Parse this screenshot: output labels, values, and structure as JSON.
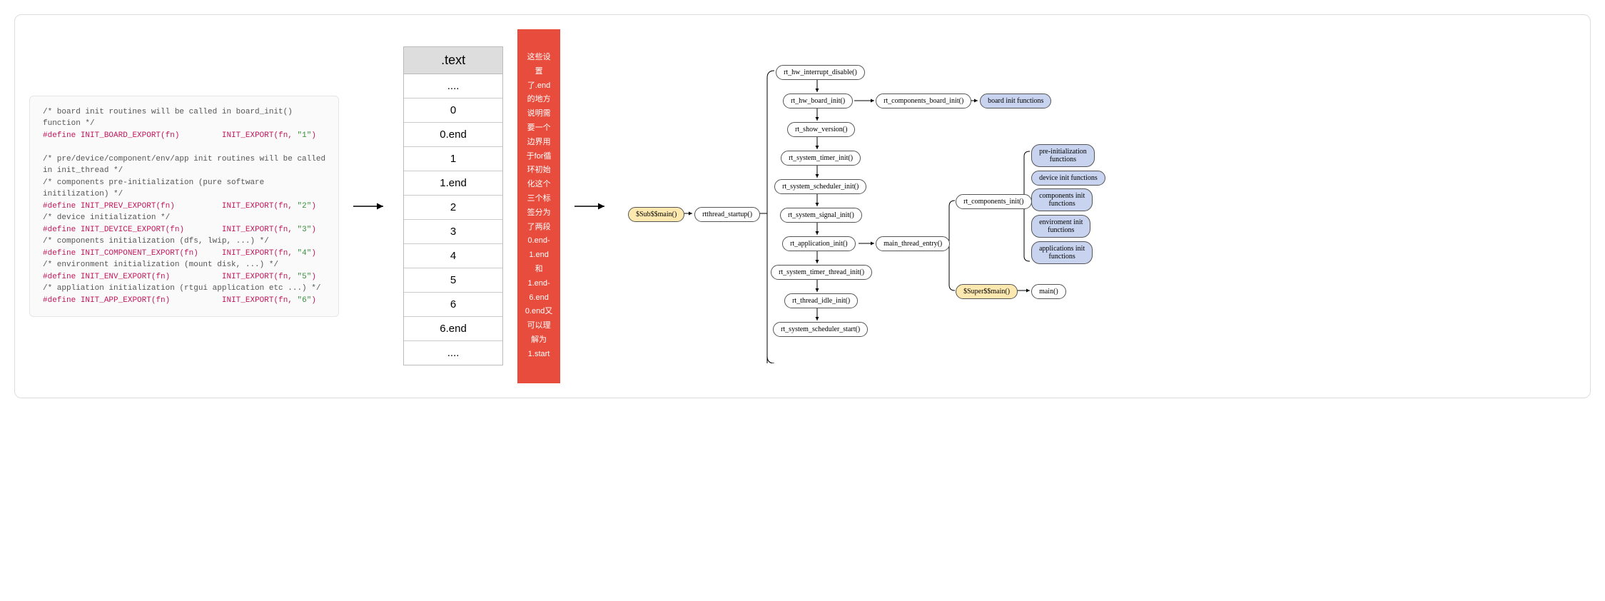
{
  "code": {
    "c1": "/* board init routines will be called in board_init()\nfunction */",
    "d1a": "#define",
    "d1b": "INIT_BOARD_EXPORT(fn)",
    "d1c": "INIT_EXPORT(fn,",
    "d1d": "\"1\"",
    "d1e": ")",
    "c2": "/* pre/device/component/env/app init routines will be called\nin init_thread */",
    "c3": "/* components pre-initialization (pure software\ninitilization) */",
    "d2a": "#define",
    "d2b": "INIT_PREV_EXPORT(fn)",
    "d2c": "INIT_EXPORT(fn,",
    "d2d": "\"2\"",
    "d2e": ")",
    "c4": "/* device initialization */",
    "d3a": "#define",
    "d3b": "INIT_DEVICE_EXPORT(fn)",
    "d3c": "INIT_EXPORT(fn,",
    "d3d": "\"3\"",
    "d3e": ")",
    "c5": "/* components initialization (dfs, lwip, ...) */",
    "d4a": "#define",
    "d4b": "INIT_COMPONENT_EXPORT(fn)",
    "d4c": "INIT_EXPORT(fn,",
    "d4d": "\"4\"",
    "d4e": ")",
    "c6": "/* environment initialization (mount disk, ...) */",
    "d5a": "#define",
    "d5b": "INIT_ENV_EXPORT(fn)",
    "d5c": "INIT_EXPORT(fn,",
    "d5d": "\"5\"",
    "d5e": ")",
    "c7": "/* appliation initialization (rtgui application etc ...) */",
    "d6a": "#define",
    "d6b": "INIT_APP_EXPORT(fn)",
    "d6c": "INIT_EXPORT(fn,",
    "d6d": "\"6\"",
    "d6e": ")"
  },
  "table": {
    "header": ".text",
    "rows": [
      "....",
      "0",
      "0.end",
      "1",
      "1.end",
      "2",
      "3",
      "4",
      "5",
      "6",
      "6.end",
      "...."
    ]
  },
  "annotation": "这些设置了.end的地方说明需要一个边界用于for循环初始化这个三个标签分为了两段\n0.end-1.end\n和\n1.end-6.end\n0.end又可以理解为1.start",
  "flow": {
    "sub_main": "$Sub$$main()",
    "rtthread_startup": "rtthread_startup()",
    "hw_interrupt": "rt_hw_interrupt_disable()",
    "hw_board": "rt_hw_board_init()",
    "comp_board": "rt_components_board_init()",
    "board_init_fn": "board init functions",
    "show_version": "rt_show_version()",
    "timer_init": "rt_system_timer_init()",
    "scheduler_init": "rt_system_scheduler_init()",
    "signal_init": "rt_system_signal_init()",
    "app_init": "rt_application_init()",
    "main_thread": "main_thread_entry()",
    "timer_thread": "rt_system_timer_thread_init()",
    "idle_init": "rt_thread_idle_init()",
    "scheduler_start": "rt_system_scheduler_start()",
    "comp_init": "rt_components_init()",
    "pre_init": "pre-initialization\nfunctions",
    "dev_init": "device init functions",
    "comp_init_fn": "components init\nfunctions",
    "env_init": "enviroment init\nfunctions",
    "app_init_fn": "applications init\nfunctions",
    "super_main": "$Super$$main()",
    "main": "main()"
  },
  "chart_data": {
    "type": "diagram",
    "title": "RT-Thread initialization flow",
    "code_macros": [
      {
        "macro": "INIT_BOARD_EXPORT(fn)",
        "expands_to": "INIT_EXPORT(fn, \"1\")",
        "comment": "board init routines will be called in board_init() function"
      },
      {
        "macro": "INIT_PREV_EXPORT(fn)",
        "expands_to": "INIT_EXPORT(fn, \"2\")",
        "comment": "components pre-initialization (pure software initilization)"
      },
      {
        "macro": "INIT_DEVICE_EXPORT(fn)",
        "expands_to": "INIT_EXPORT(fn, \"3\")",
        "comment": "device initialization"
      },
      {
        "macro": "INIT_COMPONENT_EXPORT(fn)",
        "expands_to": "INIT_EXPORT(fn, \"4\")",
        "comment": "components initialization (dfs, lwip, ...)"
      },
      {
        "macro": "INIT_ENV_EXPORT(fn)",
        "expands_to": "INIT_EXPORT(fn, \"5\")",
        "comment": "environment initialization (mount disk, ...)"
      },
      {
        "macro": "INIT_APP_EXPORT(fn)",
        "expands_to": "INIT_EXPORT(fn, \"6\")",
        "comment": "appliation initialization (rtgui application etc ...)"
      }
    ],
    "text_section_layout": [
      "....",
      "0",
      "0.end",
      "1",
      "1.end",
      "2",
      "3",
      "4",
      "5",
      "6",
      "6.end",
      "...."
    ],
    "annotation_zh": "这些设置了.end的地方说明需要一个边界用于for循环初始化这个三个标签分为了两段 0.end-1.end 和 1.end-6.end 0.end又可以理解为1.start",
    "flow_edges": [
      [
        "$Sub$$main()",
        "rtthread_startup()"
      ],
      [
        "rtthread_startup()",
        "rt_hw_interrupt_disable()"
      ],
      [
        "rt_hw_interrupt_disable()",
        "rt_hw_board_init()"
      ],
      [
        "rt_hw_board_init()",
        "rt_components_board_init()"
      ],
      [
        "rt_components_board_init()",
        "board init functions"
      ],
      [
        "rt_hw_board_init()",
        "rt_show_version()"
      ],
      [
        "rt_show_version()",
        "rt_system_timer_init()"
      ],
      [
        "rt_system_timer_init()",
        "rt_system_scheduler_init()"
      ],
      [
        "rt_system_scheduler_init()",
        "rt_system_signal_init()"
      ],
      [
        "rt_system_signal_init()",
        "rt_application_init()"
      ],
      [
        "rt_application_init()",
        "main_thread_entry()"
      ],
      [
        "rt_application_init()",
        "rt_system_timer_thread_init()"
      ],
      [
        "rt_system_timer_thread_init()",
        "rt_thread_idle_init()"
      ],
      [
        "rt_thread_idle_init()",
        "rt_system_scheduler_start()"
      ],
      [
        "main_thread_entry()",
        "rt_components_init()"
      ],
      [
        "rt_components_init()",
        "pre-initialization functions"
      ],
      [
        "rt_components_init()",
        "device init functions"
      ],
      [
        "rt_components_init()",
        "components init functions"
      ],
      [
        "rt_components_init()",
        "enviroment init functions"
      ],
      [
        "rt_components_init()",
        "applications init functions"
      ],
      [
        "main_thread_entry()",
        "$Super$$main()"
      ],
      [
        "$Super$$main()",
        "main()"
      ]
    ]
  }
}
